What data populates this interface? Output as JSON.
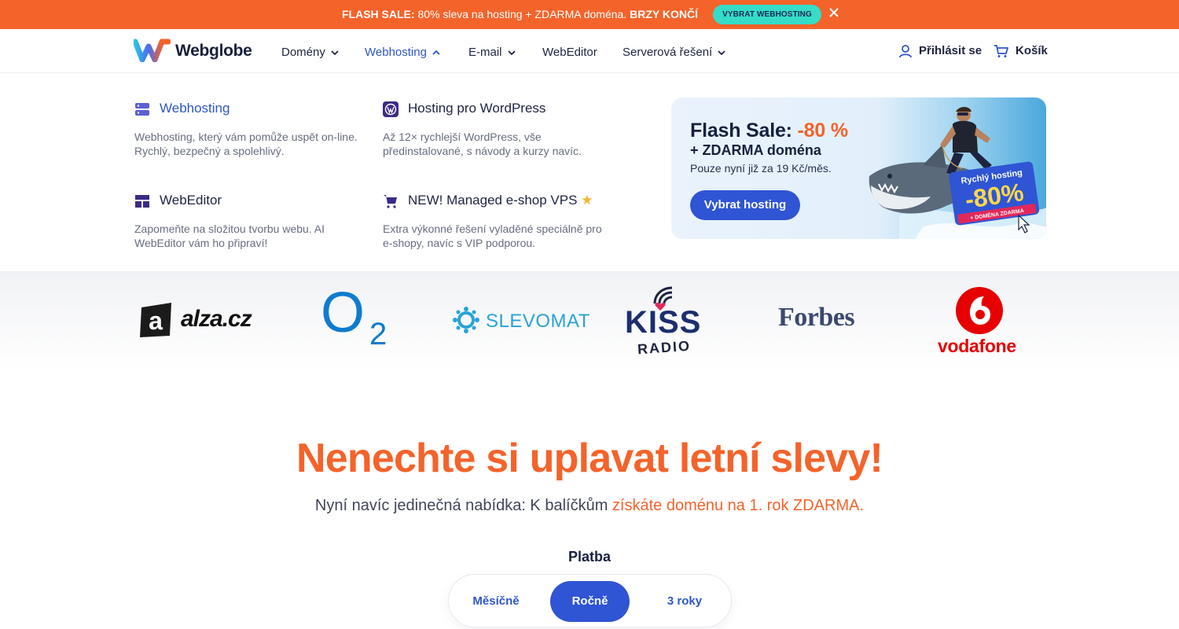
{
  "promo": {
    "bold_prefix": "FLASH SALE:",
    "text": " 80% sleva na hosting + ZDARMA doména. ",
    "bold_suffix": "BRZY KONČÍ",
    "button": "VYBRAT WEBHOSTING",
    "close_icon": "close-icon"
  },
  "header": {
    "logo_text": "Webglobe",
    "nav": [
      {
        "label": "Domény"
      },
      {
        "label": "Webhosting"
      },
      {
        "label": "E-mail"
      },
      {
        "label": "WebEditor"
      },
      {
        "label": "Serverová řešení"
      }
    ],
    "login": "Přihlásit se",
    "cart": "Košík"
  },
  "menu": {
    "items": [
      {
        "title": "Webhosting",
        "desc": "Webhosting, který vám pomůže uspět on-line. Rychlý, bezpečný a spolehlivý.",
        "icon": "server-icon"
      },
      {
        "title": "Hosting pro WordPress",
        "desc": "Až 12× rychlejší WordPress, vše předinstalované, s návody a kurzy navíc.",
        "icon": "wordpress-icon"
      },
      {
        "title": "WebEditor",
        "desc": "Zapomeňte na složitou tvorbu webu. AI WebEditor vám ho připraví!",
        "icon": "layout-icon"
      },
      {
        "title": "NEW! Managed e-shop VPS",
        "title_star": "★",
        "desc": "Extra výkonné řešení vyladěné speciálně pro e-shopy, navíc s VIP podporou.",
        "icon": "cart-icon"
      }
    ],
    "card": {
      "title_prefix": "Flash Sale:",
      "title_discount": "-80 %",
      "subtitle": "+ ZDARMA doména",
      "price": "Pouze nyní již za 19 Kč/měs.",
      "button": "Vybrat hosting",
      "badge_line1": "Rychlý hosting",
      "badge_line2": "-80%",
      "badge_line3": "+ DOMÉNA ZDARMA"
    }
  },
  "brands": {
    "alza": "alza.cz",
    "alza_letter": "a",
    "o2": "O",
    "o2_sub": "2",
    "slevomat": "SLEVOMAT",
    "kiss": "KISS",
    "kiss_radio": "RADIO",
    "forbes": "Forbes",
    "vodafone": "vodafone"
  },
  "section": {
    "headline": "Nenechte si uplavat letní slevy!",
    "sub_plain": "Nyní navíc jedinečná nabídka: K balíčkům ",
    "sub_highlight": "získáte doménu na 1. rok ZDARMA.",
    "platba_label": "Platba",
    "billing": [
      {
        "label": "Měsíčně",
        "selected": false
      },
      {
        "label": "Ročně",
        "selected": true
      },
      {
        "label": "3 roky",
        "selected": false
      }
    ]
  },
  "colors": {
    "accent_orange": "#f4632a",
    "primary_blue": "#2f55d4",
    "promo_button": "#35dcc8"
  }
}
